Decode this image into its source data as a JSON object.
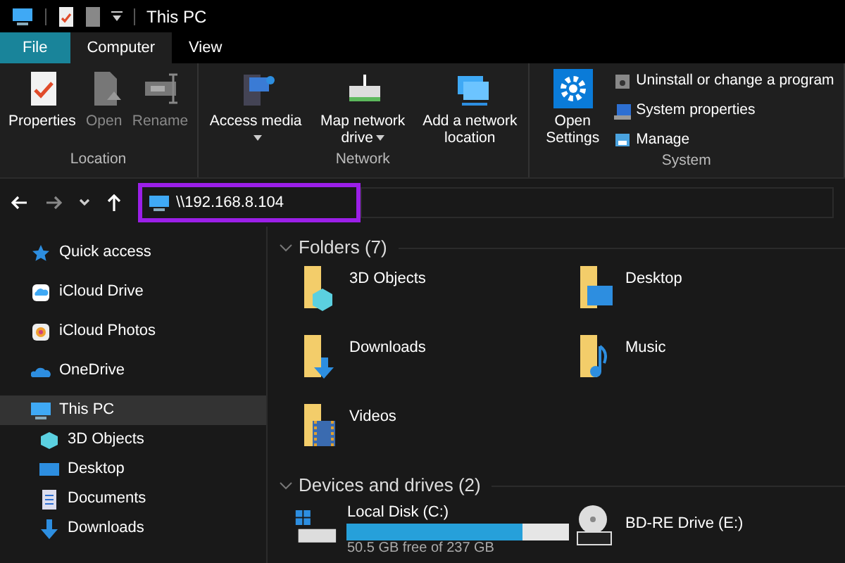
{
  "window": {
    "title": "This PC"
  },
  "tabs": [
    {
      "label": "File",
      "selected": false,
      "kind": "file"
    },
    {
      "label": "Computer",
      "selected": true,
      "kind": "tab"
    },
    {
      "label": "View",
      "selected": false,
      "kind": "tab"
    }
  ],
  "ribbon": {
    "groups": [
      {
        "label": "Location",
        "buttons": [
          {
            "label": "Properties",
            "disabled": false
          },
          {
            "label": "Open",
            "disabled": true
          },
          {
            "label": "Rename",
            "disabled": true
          }
        ]
      },
      {
        "label": "Network",
        "buttons": [
          {
            "label": "Access media",
            "dropdown": true
          },
          {
            "label": "Map network drive",
            "dropdown": true
          },
          {
            "label": "Add a network location",
            "dropdown": false
          }
        ]
      },
      {
        "label": "System",
        "buttons": [
          {
            "label": "Open Settings"
          }
        ],
        "small_buttons": [
          "Uninstall or change a program",
          "System properties",
          "Manage"
        ]
      }
    ]
  },
  "address_bar": {
    "value": "\\\\192.168.8.104"
  },
  "sidebar": {
    "items": [
      {
        "label": "Quick access",
        "selected": false
      },
      {
        "label": "iCloud Drive",
        "selected": false
      },
      {
        "label": "iCloud Photos",
        "selected": false
      },
      {
        "label": "OneDrive",
        "selected": false
      },
      {
        "label": "This PC",
        "selected": true,
        "children": [
          {
            "label": "3D Objects"
          },
          {
            "label": "Desktop"
          },
          {
            "label": "Documents"
          },
          {
            "label": "Downloads"
          }
        ]
      }
    ]
  },
  "folders": {
    "heading": "Folders (7)",
    "items": [
      "3D Objects",
      "Desktop",
      "Downloads",
      "Music",
      "Videos"
    ]
  },
  "drives": {
    "heading": "Devices and drives (2)",
    "items": [
      {
        "name": "Local Disk (C:)",
        "kind": "disk",
        "level": 0.79,
        "free": "50.5 GB free of 237 GB"
      },
      {
        "name": "BD-RE Drive (E:)",
        "kind": "optical"
      }
    ]
  }
}
